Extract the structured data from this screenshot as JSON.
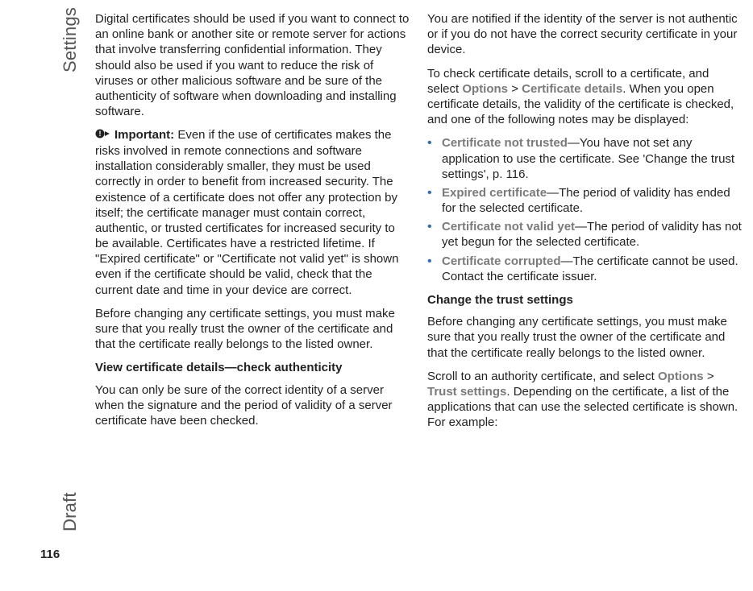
{
  "side": {
    "section": "Settings",
    "watermark": "Draft",
    "page_number": "116"
  },
  "col1": {
    "p1": "Digital certificates should be used if you want to connect to an online bank or another site or remote server for actions that involve transferring confidential information. They should also be used if you want to reduce the risk of viruses or other malicious software and be sure of the authenticity of software when downloading and installing software.",
    "important_label": "Important:",
    "important_body": " Even if the use of certificates makes the risks involved in remote connections and software installation considerably smaller, they must be used correctly in order to benefit from increased security. The existence of a certificate does not offer any protection by itself; the certificate manager must contain correct, authentic, or trusted certificates for increased security to be available. Certificates have a restricted lifetime. If \"Expired certificate\" or \"Certificate not valid yet\" is shown even if the certificate should be valid, check that the current date and time in your device are correct.",
    "p3": "Before changing any certificate settings, you must make sure that you really trust the owner of the certificate and that the certificate really belongs to the listed owner.",
    "h1": "View certificate details—check authenticity",
    "p4": "You can only be sure of the correct identity of a server when the signature and the period of validity of a server certificate have been checked."
  },
  "col2": {
    "p1": "You are notified if the identity of the server is not authentic or if you do not have the correct security certificate in your device.",
    "p2a": "To check certificate details, scroll to a certificate, and select ",
    "p2_options": "Options",
    "p2_gt": " > ",
    "p2_certdetails": "Certificate details",
    "p2b": ". When you open certificate details, the validity of the certificate is checked, and one of the following notes may be displayed:",
    "bullets": [
      {
        "term": "Certificate not trusted",
        "desc": "—You have not set any application to use the certificate. See 'Change the trust settings', p. 116."
      },
      {
        "term": "Expired certificate",
        "desc": "—The period of validity has ended for the selected certificate."
      },
      {
        "term": "Certificate not valid yet",
        "desc": "—The period of validity has not yet begun for the selected certificate."
      },
      {
        "term": "Certificate corrupted",
        "desc": "—The certificate cannot be used. Contact the certificate issuer."
      }
    ],
    "h1": "Change the trust settings",
    "p3": "Before changing any certificate settings, you must make sure that you really trust the owner of the certificate and that the certificate really belongs to the listed owner.",
    "p4a": "Scroll to an authority certificate, and select ",
    "p4_options": "Options",
    "p4_gt": " > ",
    "p4_trust": "Trust settings",
    "p4b": ". Depending on the certificate, a list of the applications that can use the selected certificate is shown. For example:"
  }
}
